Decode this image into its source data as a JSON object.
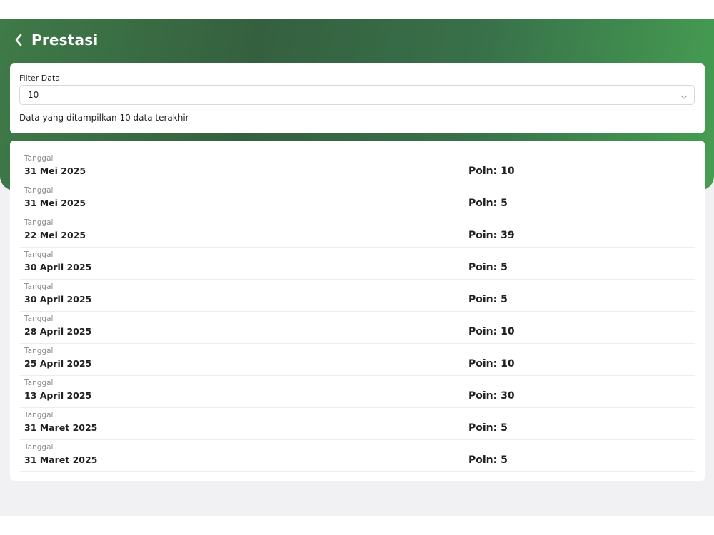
{
  "header": {
    "title": "Prestasi",
    "back_icon": "chevron-left-icon"
  },
  "filter": {
    "label": "Filter Data",
    "selected": "10",
    "note": "Data yang ditampilkan 10 data terakhir"
  },
  "records": [
    {
      "label": "Tanggal",
      "date": "31 Mei 2025",
      "points": "Poin: 10"
    },
    {
      "label": "Tanggal",
      "date": "31 Mei 2025",
      "points": "Poin: 5"
    },
    {
      "label": "Tanggal",
      "date": "22 Mei 2025",
      "points": "Poin: 39"
    },
    {
      "label": "Tanggal",
      "date": "30 April 2025",
      "points": "Poin: 5"
    },
    {
      "label": "Tanggal",
      "date": "30 April 2025",
      "points": "Poin: 5"
    },
    {
      "label": "Tanggal",
      "date": "28 April 2025",
      "points": "Poin: 10"
    },
    {
      "label": "Tanggal",
      "date": "25 April 2025",
      "points": "Poin: 10"
    },
    {
      "label": "Tanggal",
      "date": "13 April 2025",
      "points": "Poin: 30"
    },
    {
      "label": "Tanggal",
      "date": "31 Maret 2025",
      "points": "Poin: 5"
    },
    {
      "label": "Tanggal",
      "date": "31 Maret 2025",
      "points": "Poin: 5"
    }
  ],
  "colors": {
    "header_dark": "#35603f",
    "header_light": "#469e52",
    "background": "#f1f1f3"
  }
}
